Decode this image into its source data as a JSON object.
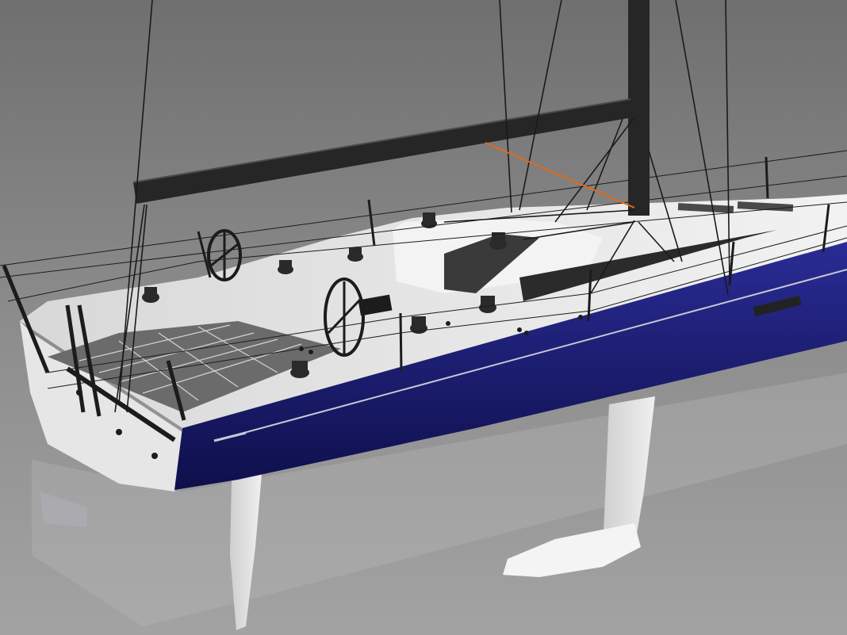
{
  "scene": {
    "subject": "sailing-yacht-render",
    "colors": {
      "background_top": "#7a7a7a",
      "background_bottom": "#9e9e9e",
      "deck": "#e9e9e9",
      "deck_shadow": "#cfcfcf",
      "hull": "#1e1f7a",
      "hull_dark": "#0f1048",
      "hull_stripe": "#c9c9d6",
      "spar": "#2a2a2a",
      "rigging": "#1a1a1a",
      "accent_line": "#e06a1a",
      "appendage": "#e8e8e8",
      "reflection": "#a8a8a8"
    }
  }
}
